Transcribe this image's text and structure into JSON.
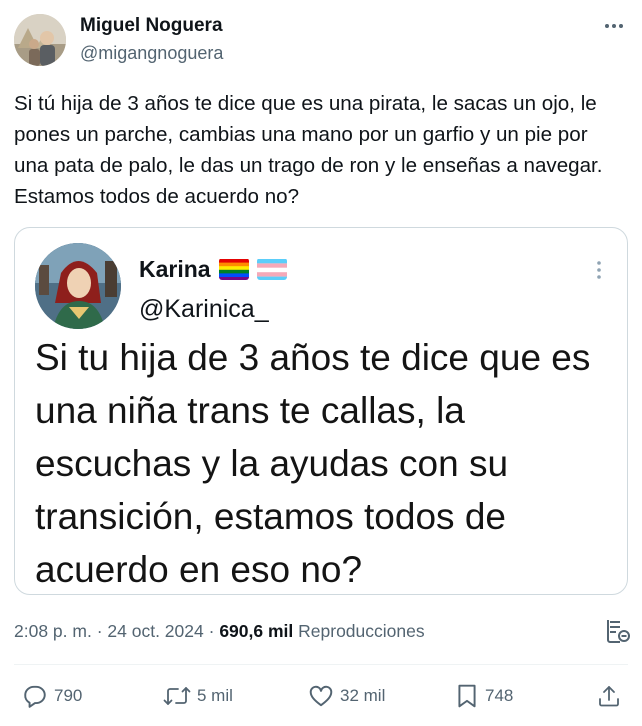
{
  "author": {
    "name": "Miguel Noguera",
    "handle": "@migangnoguera"
  },
  "tweet": {
    "text": "Si tú hija de 3 años te dice que es una pirata, le sacas un ojo, le pones un parche, cambias una mano por un garfio y un pie por una pata de palo, le das un trago de ron y le enseñas a navegar. Estamos todos de acuerdo no?"
  },
  "quote": {
    "name": "Karina",
    "flags": [
      "rainbow-flag",
      "transgender-flag"
    ],
    "handle": "@Karinica_",
    "text": "Si tu hija de 3 años te dice que es una niña trans te callas, la escuchas y la ayudas con su transición, estamos todos de acuerdo en eso no?"
  },
  "meta": {
    "time": "2:08 p. m.",
    "separator": "·",
    "date": "24 oct. 2024",
    "views_count": "690,6 mil",
    "views_label": "Reproducciones"
  },
  "actions": {
    "replies": "790",
    "reposts": "5 mil",
    "likes": "32 mil",
    "bookmarks": "748"
  },
  "icons": {
    "more": "more-horizontal-icon",
    "quote_more": "more-vertical-icon",
    "analytics": "analytics-icon",
    "reply": "reply-icon",
    "repost": "repost-icon",
    "like": "heart-icon",
    "bookmark": "bookmark-icon",
    "share": "share-icon"
  },
  "colors": {
    "text": "#0f1419",
    "secondary": "#536471",
    "border": "#cfd9de"
  }
}
